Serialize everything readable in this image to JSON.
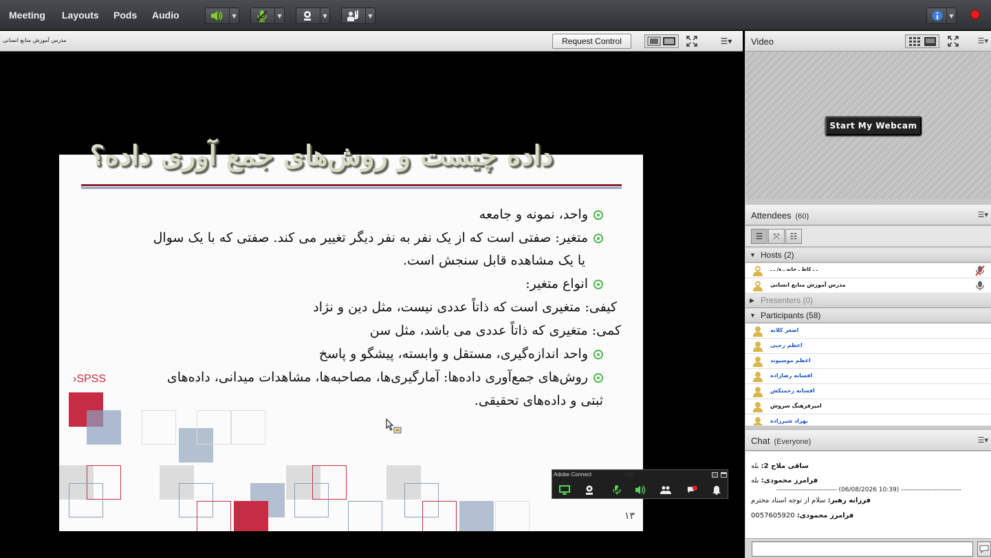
{
  "menubar": {
    "items": [
      "Meeting",
      "Layouts",
      "Pods",
      "Audio"
    ]
  },
  "colors": {
    "recording": "#e81c1c",
    "accent_green": "#4db84d",
    "link_blue": "#1a55c5",
    "slide_red": "#c0283c"
  },
  "share": {
    "title": "مدرس آموزش منابع انسانی",
    "request_control": "Request Control"
  },
  "slide": {
    "title": "داده چیست و روش‌های جمع آوری داده؟",
    "lines": [
      "واحد، نمونه و جامعه",
      "متغیر:  صفتی است که از یک نفر به نفر دیگر تغییر می کند. صفتی که با یک سوال",
      "یا یک مشاهده قابل سنجش است.",
      "انواع متغیر:",
      "کیفی: متغیری است که ذاتاً عددی نیست، مثل دین و نژاد",
      "کمی: متغیری که ذاتاً عددی می باشد، مثل سن",
      "واحد اندازه‌گیری، مستقل و وابسته، پیشگو و پاسخ",
      "روش‌های جمع‌آوری داده‌ها: آمارگیری‌ها، مصاحبه‌ها، مشاهدات میدانی، داده‌های",
      "ثبتی و داده‌های تحقیقی."
    ],
    "logo": "SPSS",
    "page": "۱۳"
  },
  "mini_bar": {
    "title": "Adobe Connect"
  },
  "video": {
    "title": "Video",
    "webcam_button": "Start My Webcam"
  },
  "attendees": {
    "title": "Attendees",
    "count": "(60)",
    "hosts_label": "Hosts (2)",
    "hosts": [
      "ـ ـ کاظ ـ خانه ـ ه/ ـ ـ",
      "مدرس آموزش منابع انسانی"
    ],
    "presenters_label": "Presenters (0)",
    "participants_label": "Participants (58)",
    "participants": [
      "اصغر کلانه",
      "اعظم رجبی",
      "اعظم موسیوند",
      "افسانه رضازاده",
      "افسانه زحمتکش",
      "امیرفرهنگ سروش",
      "بهزاد شیرزاده"
    ]
  },
  "chat": {
    "title": "Chat",
    "scope": "(Everyone)",
    "messages": [
      {
        "sender": "ساقی ملاح 2:",
        "text": "بله"
      },
      {
        "sender": "فرامرز محمودی:",
        "text": "بله"
      },
      {
        "sender": "فرزانه رهبر:",
        "text": "سلام از توجه استاد محترم"
      },
      {
        "sender": "فرامرز محمودی:",
        "text": "0057605920"
      }
    ],
    "separator": "--------------------------- (06/08/2026 10:39) ---------------------------",
    "input_value": ""
  }
}
